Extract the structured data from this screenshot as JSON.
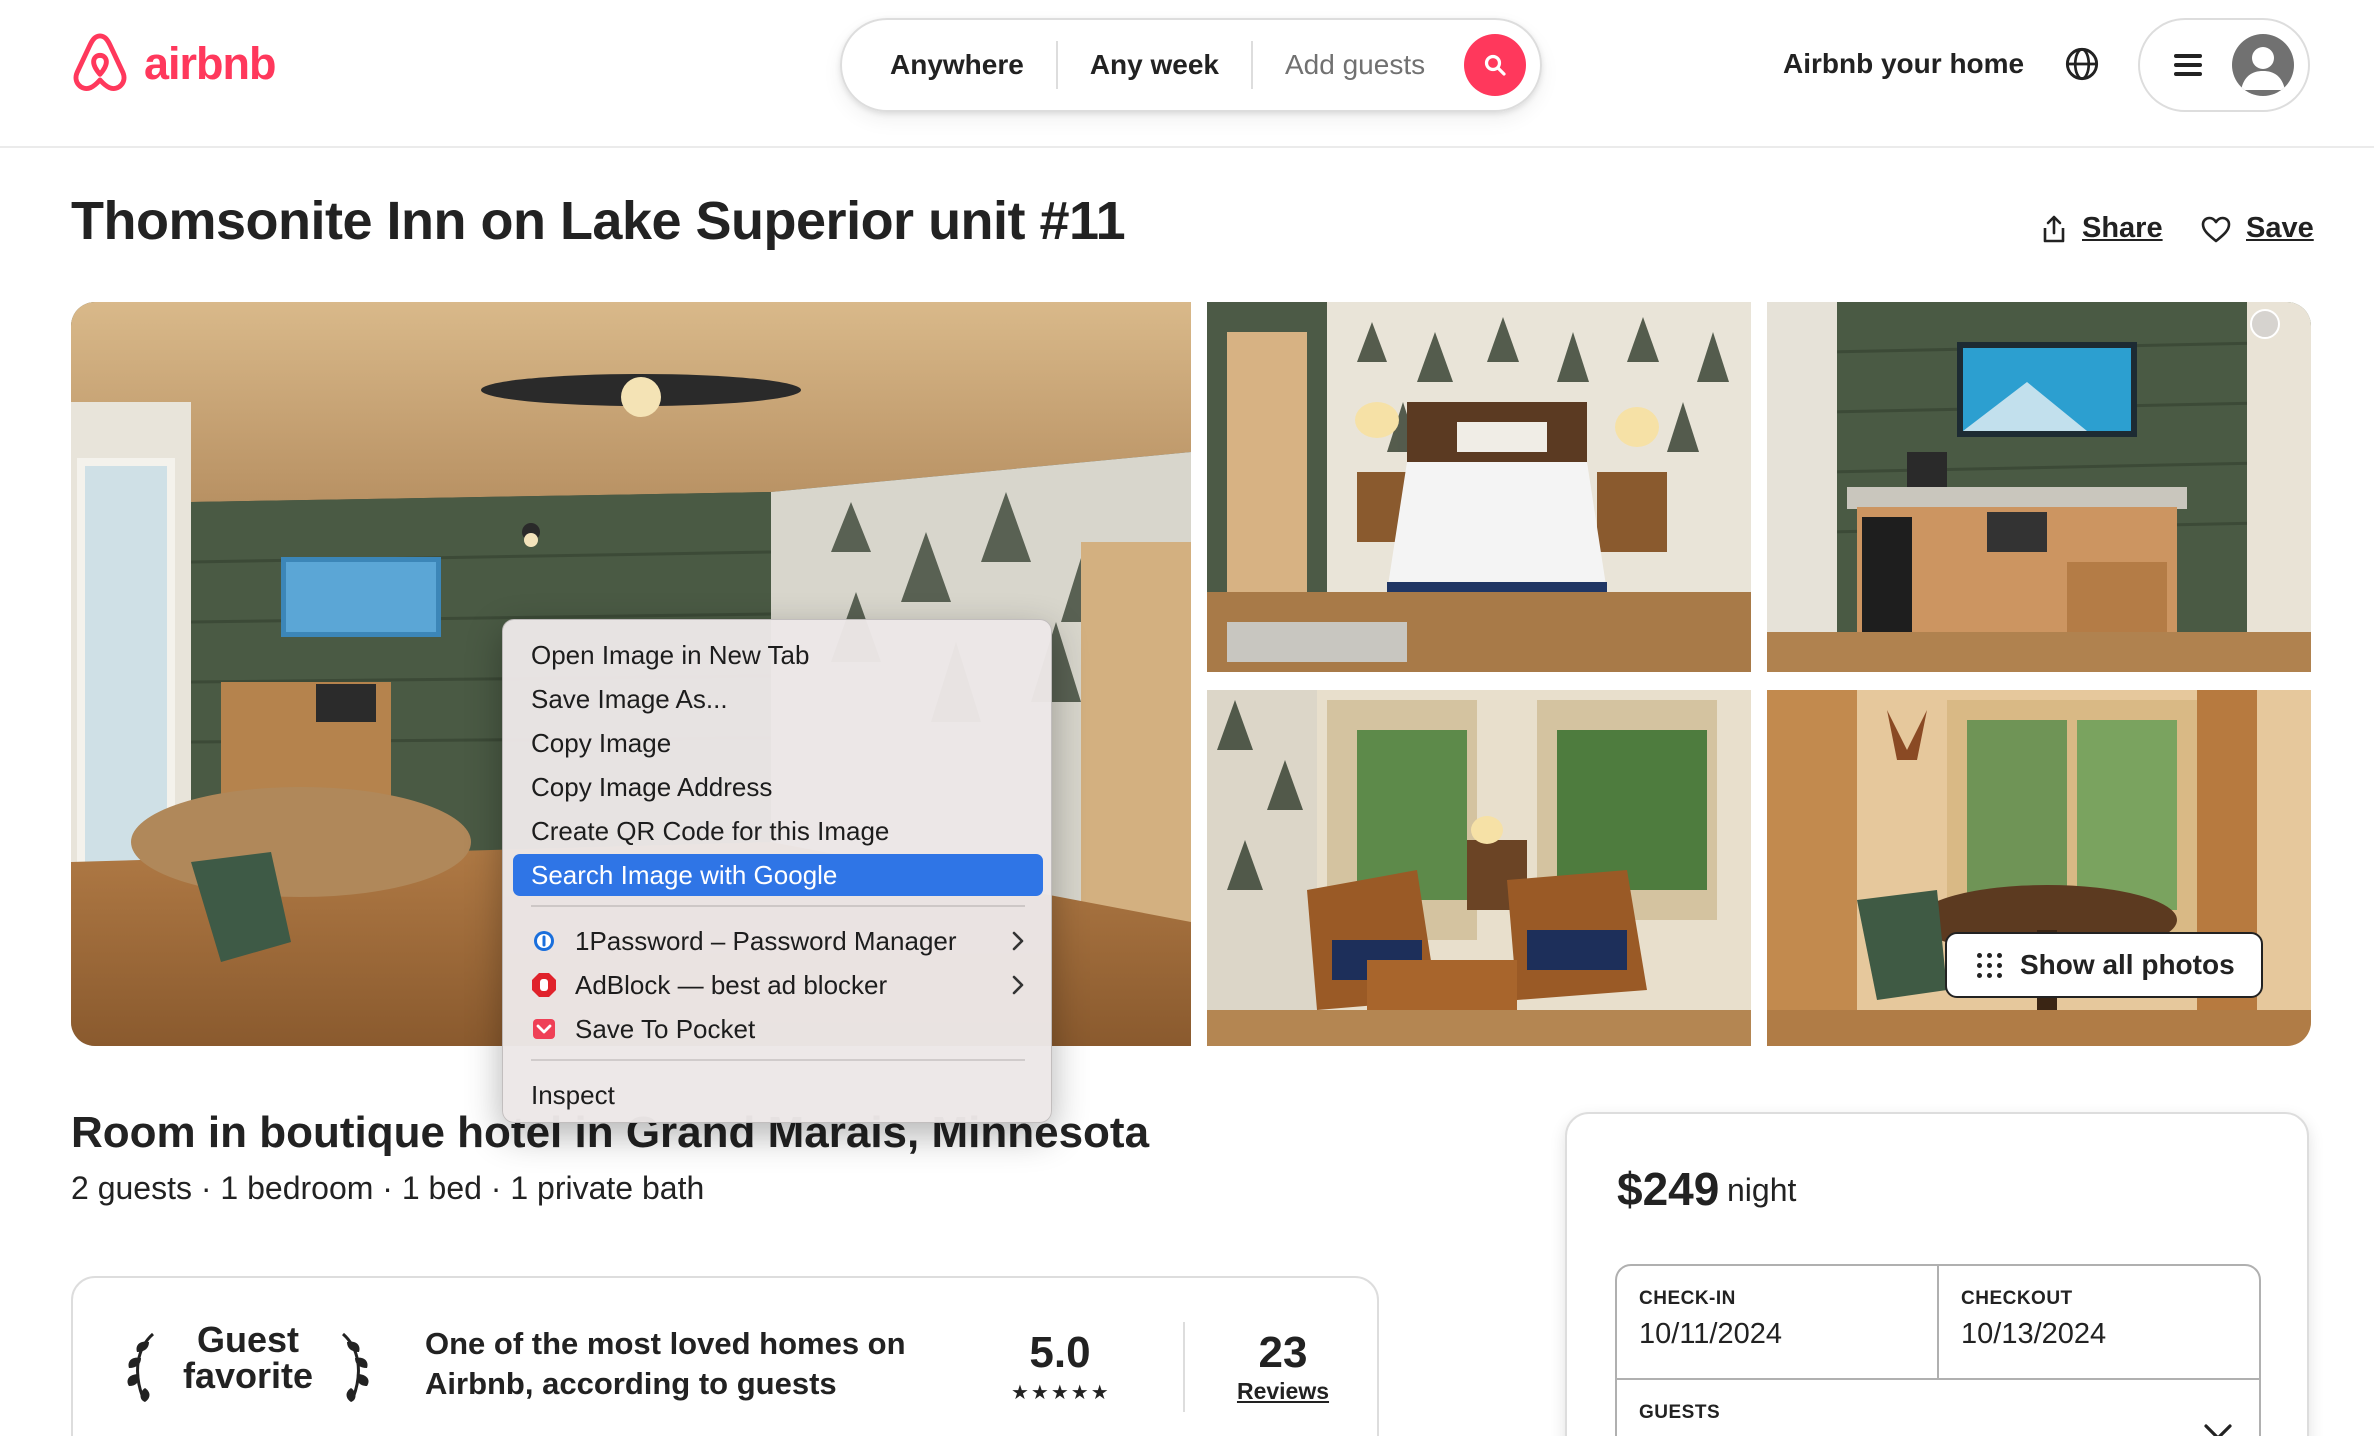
{
  "header": {
    "logo_text": "airbnb",
    "search": {
      "location": "Anywhere",
      "dates": "Any week",
      "guests_placeholder": "Add guests"
    },
    "host_link": "Airbnb your home"
  },
  "listing": {
    "title": "Thomsonite Inn on Lake Superior unit #11",
    "share_label": "Share",
    "save_label": "Save",
    "show_all_photos": "Show all photos",
    "subtitle": "Room in boutique hotel in Grand Marais, Minnesota",
    "details": "2 guests · 1 bedroom · 1 bed · 1 private bath"
  },
  "guest_favorite": {
    "label": "Guest favorite",
    "description": "One of the most loved homes on Airbnb, according to guests",
    "rating": "5.0",
    "stars": "★★★★★",
    "reviews_count": "23",
    "reviews_label": "Reviews"
  },
  "booking": {
    "price": "$249",
    "unit": "night",
    "checkin_label": "CHECK-IN",
    "checkin_value": "10/11/2024",
    "checkout_label": "CHECKOUT",
    "checkout_value": "10/13/2024",
    "guests_label": "GUESTS"
  },
  "context_menu": {
    "items": [
      "Open Image in New Tab",
      "Save Image As...",
      "Copy Image",
      "Copy Image Address",
      "Create QR Code for this Image",
      "Search Image with Google"
    ],
    "extensions": [
      {
        "label": "1Password – Password Manager",
        "icon": "1password-icon"
      },
      {
        "label": "AdBlock — best ad blocker",
        "icon": "adblock-icon"
      },
      {
        "label": "Save To Pocket",
        "icon": "pocket-icon"
      }
    ],
    "inspect": "Inspect"
  },
  "colors": {
    "brand": "#ff385c",
    "menu_highlight": "#2f75e6",
    "text": "#222222",
    "muted": "#717171"
  }
}
